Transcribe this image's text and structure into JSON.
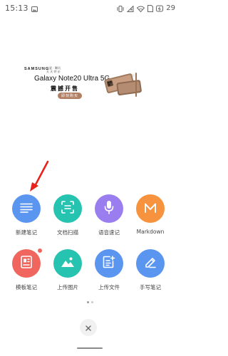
{
  "status_bar": {
    "time": "15:13",
    "battery": "29"
  },
  "banner": {
    "brand": "SAMSUNG",
    "brand_sub_1": "三星 · 腾讯",
    "brand_sub_2": "天 天 特 价",
    "model": "Galaxy Note20 Ultra 5G",
    "headline": "震撼开售",
    "cta": "即刻购买"
  },
  "actions": [
    {
      "label": "新建笔记",
      "icon": "note-lines-icon",
      "color": "#5a95f0"
    },
    {
      "label": "文档扫描",
      "icon": "scan-icon",
      "color": "#26c4b0"
    },
    {
      "label": "语音速记",
      "icon": "microphone-icon",
      "color": "#9a7ef0"
    },
    {
      "label": "Markdown",
      "icon": "markdown-icon",
      "color": "#f7933f"
    },
    {
      "label": "模板笔记",
      "icon": "template-icon",
      "color": "#f0655e",
      "badge": true
    },
    {
      "label": "上传图片",
      "icon": "image-icon",
      "color": "#26c4b0"
    },
    {
      "label": "上传文件",
      "icon": "upload-file-icon",
      "color": "#5a95f0"
    },
    {
      "label": "手写笔记",
      "icon": "handwriting-icon",
      "color": "#5a95f0"
    }
  ],
  "pagination": {
    "current": 1,
    "total": 2
  }
}
